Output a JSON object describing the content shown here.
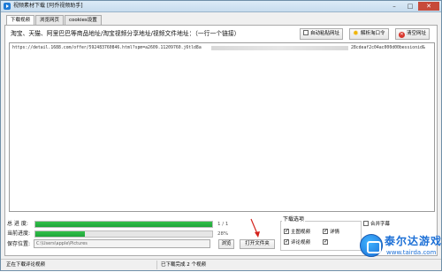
{
  "window": {
    "title": "视频素材下载 [阿乔视频助手]"
  },
  "tabs": [
    {
      "label": "下载视频"
    },
    {
      "label": "浏览网页"
    },
    {
      "label": "cookies设置"
    }
  ],
  "toolbar": {
    "url_hint": "淘宝、天猫、阿里巴巴等商品地址/淘宝视频分享地址/视频文件地址：（一行一个链接）",
    "auto_fetch_label": "自动粘贴网址",
    "auto_fetch_checked": false,
    "parse_button": "解析淘口令",
    "clear_button": "清空网址"
  },
  "url_input": {
    "line1_prefix": "https://detail.1688.com/offer/592483760846.html?spm=a2609.11209760.j6tld8a",
    "line1_suffix": "28cdeaf2c04ac000d00bessionid&"
  },
  "progress": {
    "total_label": "总 进 度:",
    "total_value": "1 / 1",
    "total_fraction": 1.0,
    "current_label": "当前进度:",
    "current_value": "28%",
    "current_fraction": 0.28
  },
  "save": {
    "label": "保存位置:",
    "path": "C:\\Users\\apple\\Pictures",
    "browse_button": "浏览",
    "open_folder_button": "打开文件夹"
  },
  "download_options": {
    "title": "下载选项",
    "items": [
      {
        "label": "主图视频",
        "checked": true
      },
      {
        "label": "详情",
        "checked": true
      },
      {
        "label": "评论视频",
        "checked": true
      },
      {
        "label": "",
        "checked": true
      }
    ],
    "extra_label": "合并字幕",
    "extra_checked": false
  },
  "status": {
    "left": "正在下载评论视频",
    "mid": "已下载完成 2 个视频"
  },
  "watermark": {
    "cn": "泰尔达游戏网",
    "en": "www.tairda.com"
  }
}
